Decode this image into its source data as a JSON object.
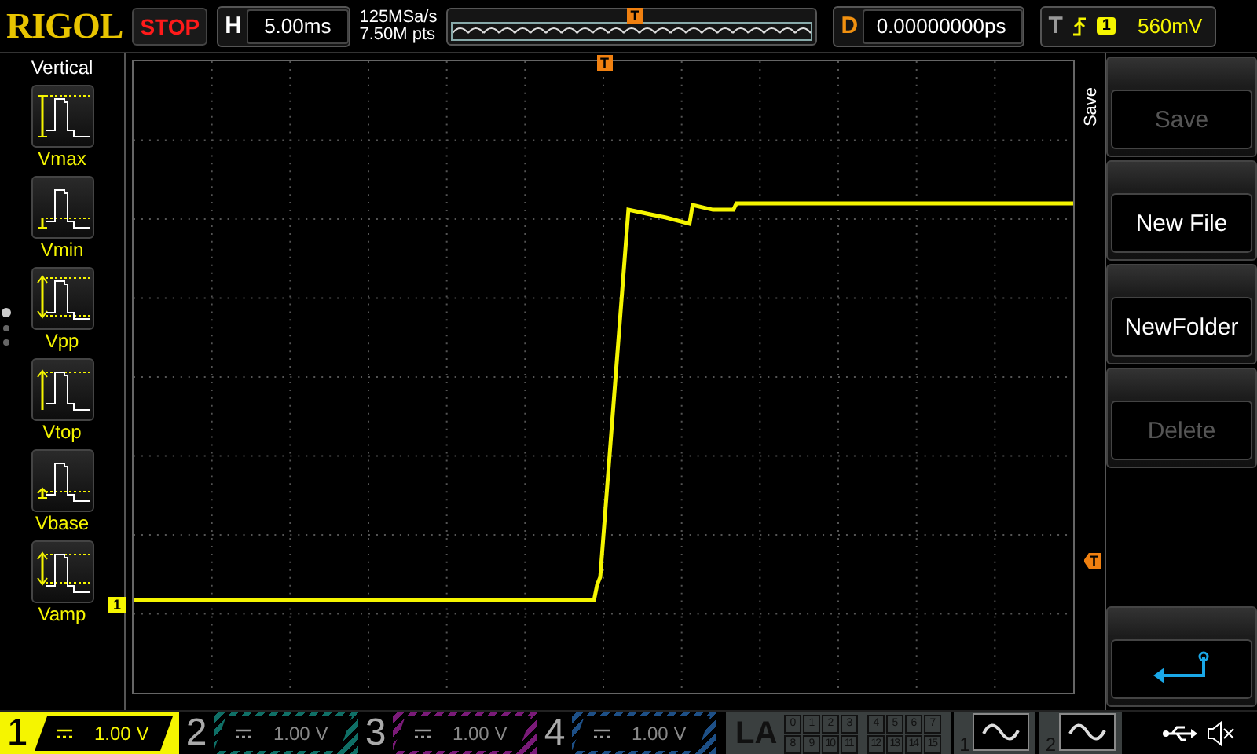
{
  "logo": "RIGOL",
  "run_state": "STOP",
  "horizontal": {
    "label": "H",
    "value": "5.00ms"
  },
  "acquisition": {
    "sample_rate": "125MSa/s",
    "memory_depth": "7.50M pts"
  },
  "memory_bar": {
    "trigger_marker": "T"
  },
  "delay": {
    "label": "D",
    "value": "0.00000000ps"
  },
  "trigger": {
    "label": "T",
    "source": "1",
    "threshold": "560mV"
  },
  "measure_menu": {
    "title": "Vertical",
    "items": [
      {
        "label": "Vmax",
        "kind": "max"
      },
      {
        "label": "Vmin",
        "kind": "min"
      },
      {
        "label": "Vpp",
        "kind": "pp"
      },
      {
        "label": "Vtop",
        "kind": "top"
      },
      {
        "label": "Vbase",
        "kind": "base"
      },
      {
        "label": "Vamp",
        "kind": "amp"
      }
    ],
    "pages": [
      {
        "selected": true
      },
      {
        "selected": false
      },
      {
        "selected": false
      }
    ]
  },
  "screen": {
    "channel_marker": "1",
    "trigger_position_marker": "T",
    "trigger_level_marker": "T"
  },
  "softkeys": {
    "title": "Save",
    "buttons": [
      {
        "kind": "text",
        "label": "Save",
        "disabled": true
      },
      {
        "kind": "text",
        "label": "New File",
        "disabled": false
      },
      {
        "kind": "text",
        "label": "NewFolder",
        "disabled": false
      },
      {
        "kind": "text",
        "label": "Delete",
        "disabled": true
      },
      {
        "kind": "back"
      }
    ]
  },
  "channels": [
    {
      "number": "1",
      "scale": "1.00 V",
      "on": true,
      "color": "#f5f500"
    },
    {
      "number": "2",
      "scale": "1.00 V",
      "on": false,
      "color": "#0f6f66"
    },
    {
      "number": "3",
      "scale": "1.00 V",
      "on": false,
      "color": "#7a1a78"
    },
    {
      "number": "4",
      "scale": "1.00 V",
      "on": false,
      "color": "#1d4f86"
    }
  ],
  "la": {
    "label": "LA",
    "channels": [
      "0",
      "1",
      "2",
      "3",
      "4",
      "5",
      "6",
      "7",
      "8",
      "9",
      "10",
      "11",
      "12",
      "13",
      "14",
      "15"
    ]
  },
  "generators": [
    {
      "number": "1"
    },
    {
      "number": "2"
    }
  ]
}
